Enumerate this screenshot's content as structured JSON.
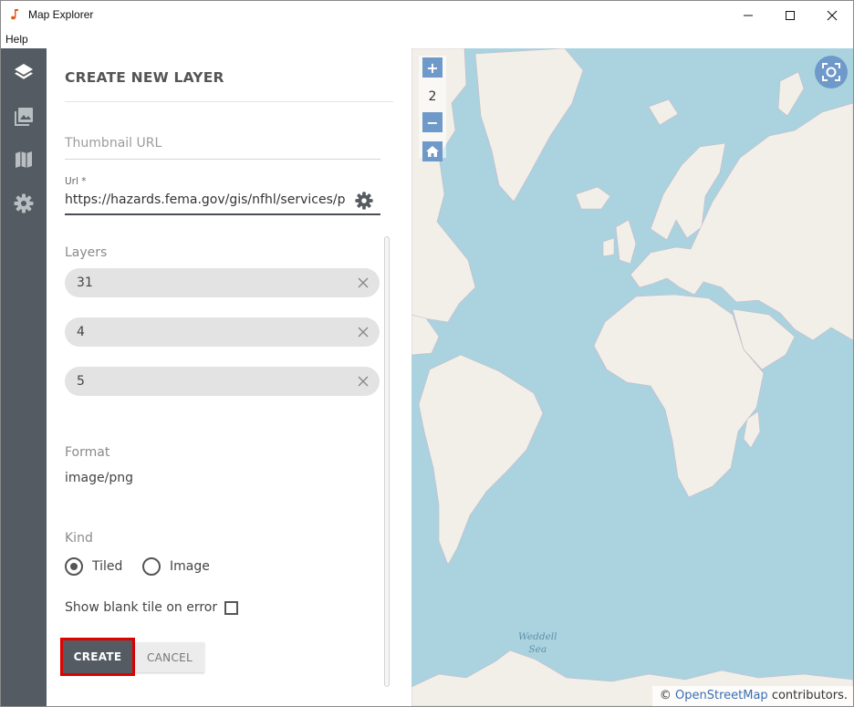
{
  "window": {
    "title": "Map Explorer",
    "controls": [
      "minimize",
      "maximize",
      "close"
    ]
  },
  "menubar": {
    "items": [
      "Help"
    ]
  },
  "rail": {
    "items": [
      {
        "name": "layers",
        "icon": "layers-icon",
        "active": true
      },
      {
        "name": "images",
        "icon": "image-icon",
        "active": false
      },
      {
        "name": "maps",
        "icon": "map-icon",
        "active": false
      },
      {
        "name": "settings",
        "icon": "gear-icon",
        "active": false
      }
    ]
  },
  "panel": {
    "title": "CREATE NEW LAYER",
    "thumbnail_placeholder": "Thumbnail URL",
    "thumbnail_value": "",
    "url_label": "Url *",
    "url_value": "https://hazards.fema.gov/gis/nfhl/services/publ",
    "layers_label": "Layers",
    "layers": [
      "31",
      "4",
      "5"
    ],
    "format_label": "Format",
    "format_value": "image/png",
    "kind_label": "Kind",
    "kind_options": [
      "Tiled",
      "Image"
    ],
    "kind_selected": "Tiled",
    "blank_tile_label": "Show blank tile on error",
    "blank_tile_checked": false,
    "create_label": "CREATE",
    "cancel_label": "CANCEL"
  },
  "map": {
    "zoom_level": "2",
    "zoom_in": "+",
    "zoom_out": "−",
    "sea_label_line1": "Weddell",
    "sea_label_line2": "Sea",
    "attribution_prefix": "©",
    "attribution_link": "OpenStreetMap",
    "attribution_suffix": "contributors.",
    "colors": {
      "water": "#aad3df",
      "land": "#f2efe9",
      "control": "#6e99c9"
    }
  },
  "colors": {
    "rail": "#545b62",
    "primary_button": "#545b62",
    "highlight": "#e00000"
  }
}
